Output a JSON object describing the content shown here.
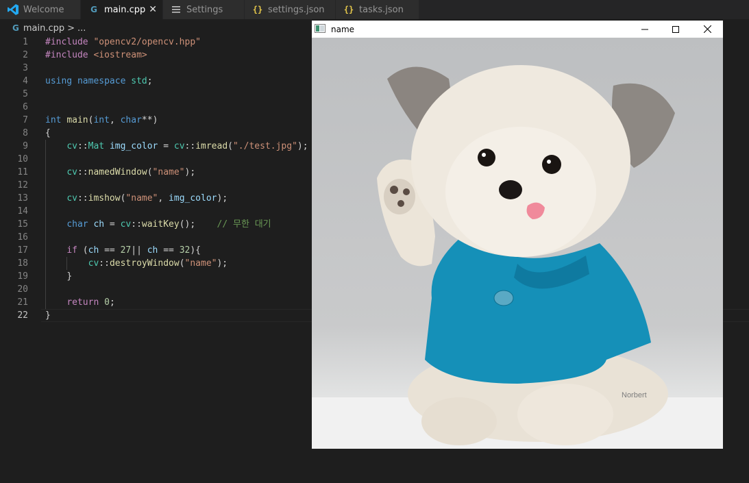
{
  "tabs": [
    {
      "label": "Welcome",
      "icon": "vscode-logo-icon",
      "active": false
    },
    {
      "label": "main.cpp",
      "icon": "cpp-file-icon",
      "active": true
    },
    {
      "label": "Settings",
      "icon": "settings-list-icon",
      "active": false
    },
    {
      "label": "settings.json",
      "icon": "json-braces-icon",
      "active": false
    },
    {
      "label": "tasks.json",
      "icon": "json-braces-icon",
      "active": false
    }
  ],
  "breadcrumb": {
    "file": "main.cpp",
    "separator": ">",
    "more": "..."
  },
  "editor": {
    "current_line": 22,
    "line_numbers": [
      "1",
      "2",
      "3",
      "4",
      "5",
      "6",
      "7",
      "8",
      "9",
      "10",
      "11",
      "12",
      "13",
      "14",
      "15",
      "16",
      "17",
      "18",
      "19",
      "20",
      "21",
      "22"
    ],
    "code": {
      "l1_pp": "#include",
      "l1_str": "\"opencv2/opencv.hpp\"",
      "l2_pp": "#include",
      "l2_str": "<iostream>",
      "l4_kw1": "using",
      "l4_kw2": "namespace",
      "l4_ns": "std",
      "l4_end": ";",
      "l7_kw": "int",
      "l7_fn": "main",
      "l7_p1": "(",
      "l7_kw2": "int",
      "l7_p2": ", ",
      "l7_kw3": "char",
      "l7_p3": "**",
      "l7_p4": ")",
      "l8": "{",
      "l9_ty1": "cv",
      "l9_sep1": "::",
      "l9_ty2": "Mat",
      "l9_var": "img_color",
      "l9_eq": " = ",
      "l9_ns": "cv",
      "l9_sep2": "::",
      "l9_fn": "imread",
      "l9_p1": "(",
      "l9_str": "\"./test.jpg\"",
      "l9_p2": ");",
      "l11_ns": "cv",
      "l11_sep": "::",
      "l11_fn": "namedWindow",
      "l11_p1": "(",
      "l11_str": "\"name\"",
      "l11_p2": ");",
      "l13_ns": "cv",
      "l13_sep": "::",
      "l13_fn": "imshow",
      "l13_p1": "(",
      "l13_str": "\"name\"",
      "l13_p2": ", ",
      "l13_var": "img_color",
      "l13_p3": ");",
      "l15_kw": "char",
      "l15_var": "ch",
      "l15_eq": " = ",
      "l15_ns": "cv",
      "l15_sep": "::",
      "l15_fn": "waitKey",
      "l15_p": "();",
      "l15_cm": "// 무한 대기",
      "l17_kw": "if",
      "l17_p1": " (",
      "l17_var1": "ch",
      "l17_op1": " == ",
      "l17_num1": "27",
      "l17_op2": "|| ",
      "l17_var2": "ch",
      "l17_op3": " == ",
      "l17_num2": "32",
      "l17_p2": "){",
      "l18_ns": "cv",
      "l18_sep": "::",
      "l18_fn": "destroyWindow",
      "l18_p1": "(",
      "l18_str": "\"name\"",
      "l18_p2": ");",
      "l19": "}",
      "l21_kw": "return",
      "l21_num": "0",
      "l21_end": ";",
      "l22": "}"
    }
  },
  "cv_window": {
    "title": "name",
    "controls": [
      "minimize-icon",
      "maximize-icon",
      "close-icon"
    ],
    "image": {
      "subject": "small white dog in blue polo shirt raising paw",
      "watermark": "Norbert"
    }
  },
  "colors": {
    "editor_bg": "#1e1e1e",
    "tab_bg": "#2d2d2d",
    "keyword": "#569cd6",
    "preprocessor": "#c586c0",
    "string": "#ce9178",
    "type": "#4ec9b0",
    "function": "#dcdcaa",
    "variable": "#9cdcfe",
    "number": "#b5cea8",
    "comment": "#6a9955",
    "shirt": "#1590b8"
  }
}
